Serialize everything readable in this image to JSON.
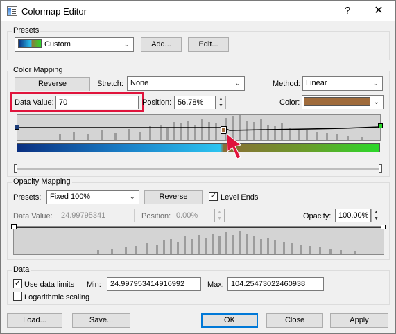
{
  "window": {
    "title": "Colormap Editor",
    "help": "?",
    "close": "✕"
  },
  "presets": {
    "group_label": "Presets",
    "selected": "Custom",
    "add_label": "Add...",
    "edit_label": "Edit..."
  },
  "color_mapping": {
    "group_label": "Color Mapping",
    "reverse_label": "Reverse",
    "stretch_label": "Stretch:",
    "stretch_value": "None",
    "method_label": "Method:",
    "method_value": "Linear",
    "data_value_label": "Data Value:",
    "data_value": "70",
    "position_label": "Position:",
    "position_value": "56.78%",
    "color_label": "Color:",
    "color_value": "#a06c3c"
  },
  "opacity_mapping": {
    "group_label": "Opacity Mapping",
    "presets_label": "Presets:",
    "presets_value": "Fixed 100%",
    "reverse_label": "Reverse",
    "level_ends_label": "Level Ends",
    "level_ends_checked": true,
    "data_value_label": "Data Value:",
    "data_value": "24.99795341",
    "position_label": "Position:",
    "position_value": "0.00%",
    "opacity_label": "Opacity:",
    "opacity_value": "100.00%"
  },
  "data": {
    "group_label": "Data",
    "use_limits_label": "Use data limits",
    "use_limits_checked": true,
    "min_label": "Min:",
    "min_value": "24.997953414916992",
    "max_label": "Max:",
    "max_value": "104.25473022460938",
    "log_label": "Logarithmic scaling",
    "log_checked": false
  },
  "footer": {
    "load_label": "Load...",
    "save_label": "Save...",
    "ok_label": "OK",
    "close_label": "Close",
    "apply_label": "Apply"
  },
  "colors": {
    "highlight_box": "#e0143c",
    "pointer": "#e0143c",
    "gradient_left": "#0a2f80",
    "gradient_mid": "#2bc4f0",
    "gradient_right": "#2ad92a",
    "selected_stop": "#a06c3c"
  },
  "icons": {
    "app": "colormap-app-icon",
    "pointer": "mouse-pointer-icon"
  }
}
